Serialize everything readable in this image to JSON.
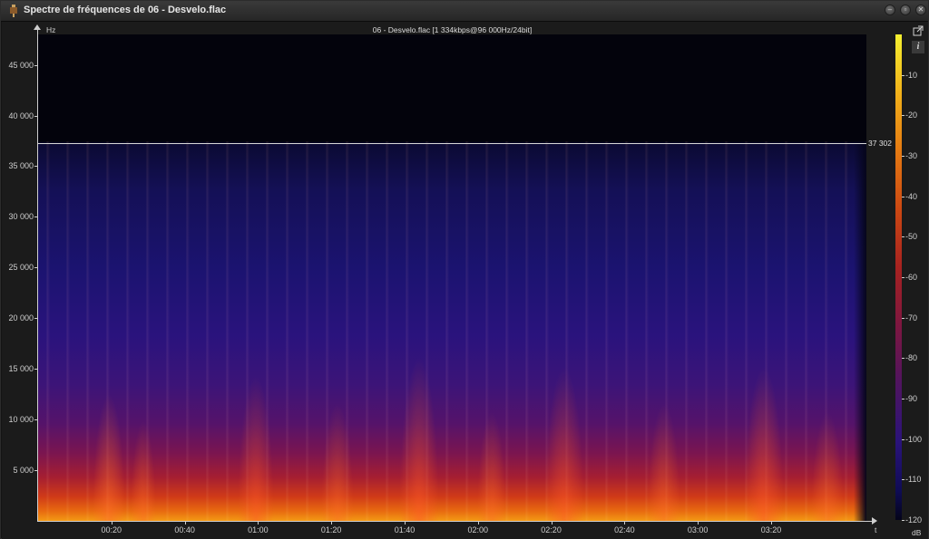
{
  "window": {
    "title": "Spectre de fréquences de 06 - Desvelo.flac",
    "buttons": {
      "minimize": "–",
      "maximize": "▫",
      "close": "✕"
    }
  },
  "plot": {
    "title": "06 - Desvelo.flac [1 334kbps@96 000Hz/24bit]",
    "y_unit": "Hz",
    "x_unit": "t",
    "y_ticks": [
      "45 000",
      "40 000",
      "35 000",
      "30 000",
      "25 000",
      "20 000",
      "15 000",
      "10 000",
      "5 000"
    ],
    "x_ticks": [
      "00:20",
      "00:40",
      "01:00",
      "01:20",
      "01:40",
      "02:00",
      "02:20",
      "02:40",
      "03:00",
      "03:20"
    ],
    "cutoff_label": "37 302",
    "cutoff_hz": 37302,
    "y_max_hz": 48000,
    "duration_s": 226
  },
  "colorbar": {
    "unit": "dB",
    "ticks": [
      "-10",
      "-20",
      "-30",
      "-40",
      "-50",
      "-60",
      "-70",
      "-80",
      "-90",
      "-100",
      "-110",
      "-120"
    ]
  },
  "side_buttons": {
    "export_icon": "external-link-icon",
    "info_label": "i"
  }
}
